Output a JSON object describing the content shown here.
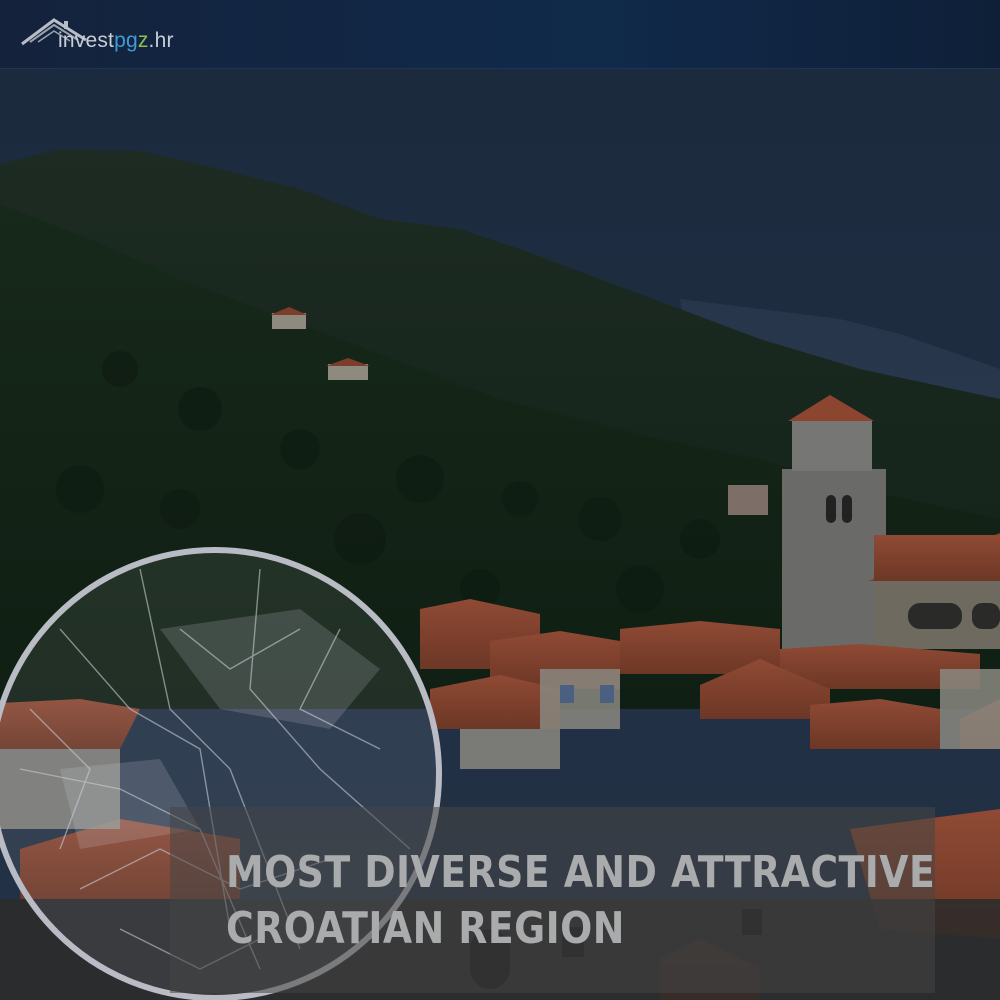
{
  "header": {
    "logo": {
      "name": "investpgz.hr",
      "prefix": "invest",
      "brand_p": "p",
      "brand_g": "g",
      "brand_z": "z",
      "suffix": ".hr"
    }
  },
  "hero": {
    "headline_line1": "MOST DIVERSE AND ATTRACTIVE",
    "headline_line2": "CROATIAN REGION",
    "image_description_icon": "aerial-village-photo"
  },
  "colors": {
    "header_bg": "#14223c",
    "brand_blue": "#3f9bd4",
    "brand_green": "#8cc04b",
    "headline_text": "#a9abad",
    "roof": "#8a4a32"
  }
}
